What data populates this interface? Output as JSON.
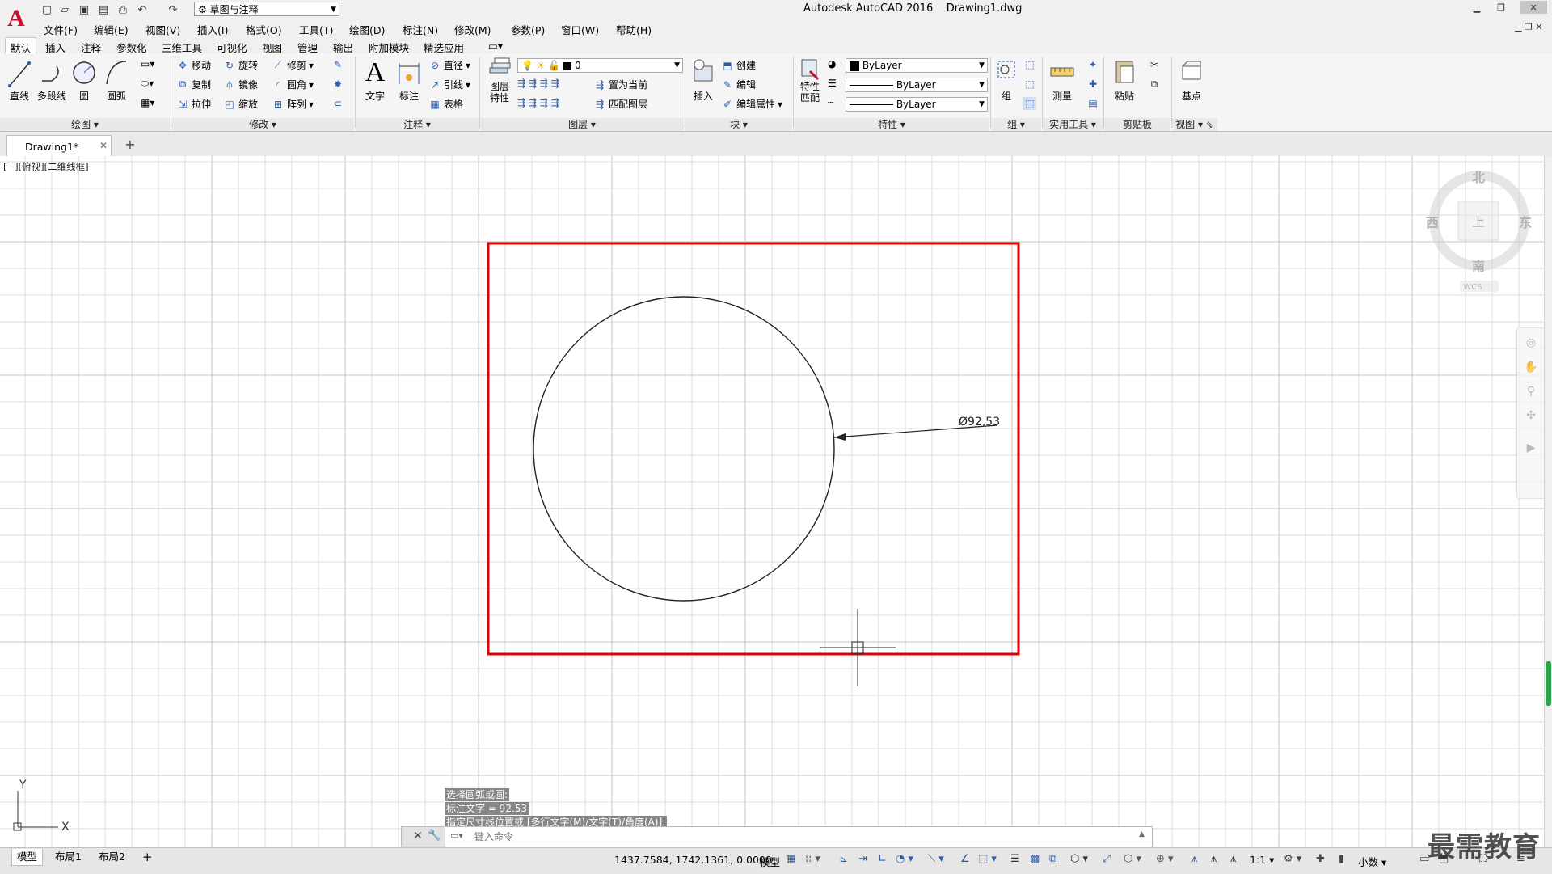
{
  "app": {
    "title": "Autodesk AutoCAD 2016",
    "document": "Drawing1.dwg",
    "workspace": "草图与注释",
    "brand_color": "#c8102e"
  },
  "menus": [
    "文件(F)",
    "编辑(E)",
    "视图(V)",
    "插入(I)",
    "格式(O)",
    "工具(T)",
    "绘图(D)",
    "标注(N)",
    "修改(M)",
    "参数(P)",
    "窗口(W)",
    "帮助(H)"
  ],
  "ribbon_tabs": [
    "默认",
    "插入",
    "注释",
    "参数化",
    "三维工具",
    "可视化",
    "视图",
    "管理",
    "输出",
    "附加模块",
    "精选应用"
  ],
  "ribbon": {
    "draw": {
      "title": "绘图",
      "line": "直线",
      "polyline": "多段线",
      "circle": "圆",
      "arc": "圆弧"
    },
    "modify": {
      "title": "修改",
      "move": "移动",
      "rotate": "旋转",
      "trim": "修剪",
      "copy": "复制",
      "mirror": "镜像",
      "fillet": "圆角",
      "stretch": "拉伸",
      "scale": "缩放",
      "array": "阵列"
    },
    "annotation": {
      "title": "注释",
      "text": "文字",
      "dimension": "标注",
      "diameter": "直径",
      "leader": "引线",
      "table": "表格"
    },
    "layers": {
      "title": "图层",
      "layer_props": "图层特性",
      "current_layer": "0",
      "set_current": "置为当前",
      "match_layer": "匹配图层"
    },
    "block": {
      "title": "块",
      "insert": "插入",
      "create": "创建",
      "edit": "编辑",
      "edit_attr": "编辑属性"
    },
    "properties": {
      "title": "特性",
      "match": "特性匹配",
      "color": "ByLayer",
      "linetype": "ByLayer",
      "lineweight": "ByLayer"
    },
    "groups": {
      "title": "组",
      "group": "组"
    },
    "utilities": {
      "title": "实用工具",
      "measure": "测量"
    },
    "clipboard": {
      "title": "剪贴板",
      "paste": "粘贴"
    },
    "view": {
      "title": "视图",
      "base": "基点"
    }
  },
  "file_tab": {
    "name": "Drawing1*"
  },
  "viewport": {
    "label": "[−][俯视][二维线框]",
    "dimension_text": "Ø92,53",
    "viewcube": {
      "north": "北",
      "south": "南",
      "east": "东",
      "west": "西",
      "top": "上",
      "wcs": "WCS"
    },
    "ucs": {
      "x": "X",
      "y": "Y"
    }
  },
  "command": {
    "history": [
      "选择圆弧或圆:",
      "标注文字 = 92.53",
      "指定尺寸线位置或 [多行文字(M)/文字(T)/角度(A)]:"
    ],
    "placeholder": "键入命令"
  },
  "status": {
    "layouts": [
      "模型",
      "布局1",
      "布局2"
    ],
    "coordinates": "1437.7584, 1742.1361, 0.0000",
    "space": "模型",
    "scale": "1:1",
    "units": "小数"
  },
  "watermark": "最需教育"
}
